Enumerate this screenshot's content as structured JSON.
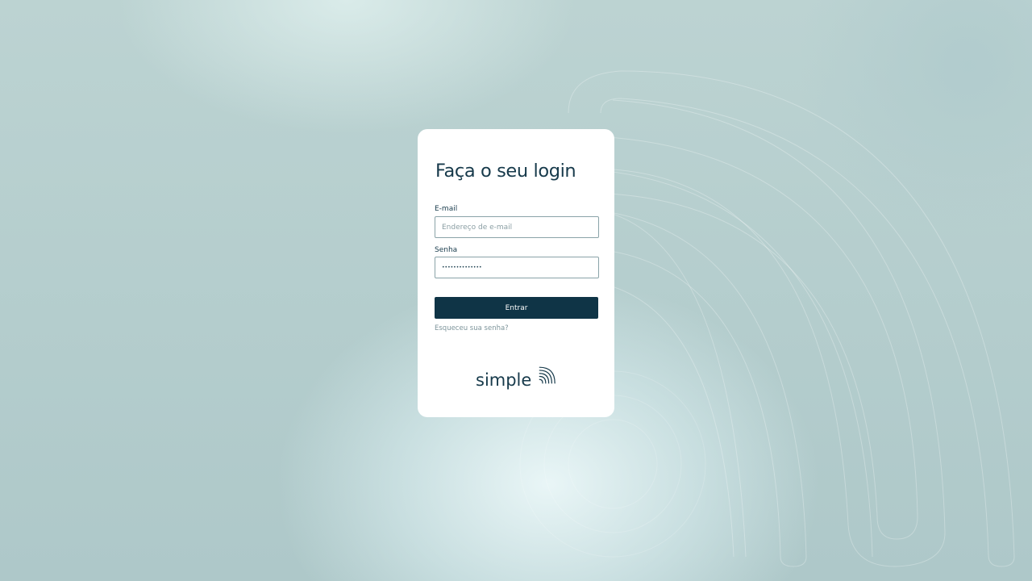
{
  "login": {
    "title": "Faça o seu login",
    "email_label": "E-mail",
    "email_placeholder": "Endereço de e-mail",
    "email_value": "",
    "password_label": "Senha",
    "password_value": "••••••••••••••",
    "submit_label": "Entrar",
    "forgot_label": "Esqueceu sua senha?"
  },
  "brand": {
    "logo_text": "simple",
    "logo_icon": "signal-waves-icon"
  },
  "colors": {
    "primary": "#0f3446",
    "text": "#173a4b",
    "muted": "#7e959b",
    "background": "#b9d0d0",
    "card": "#ffffff"
  }
}
